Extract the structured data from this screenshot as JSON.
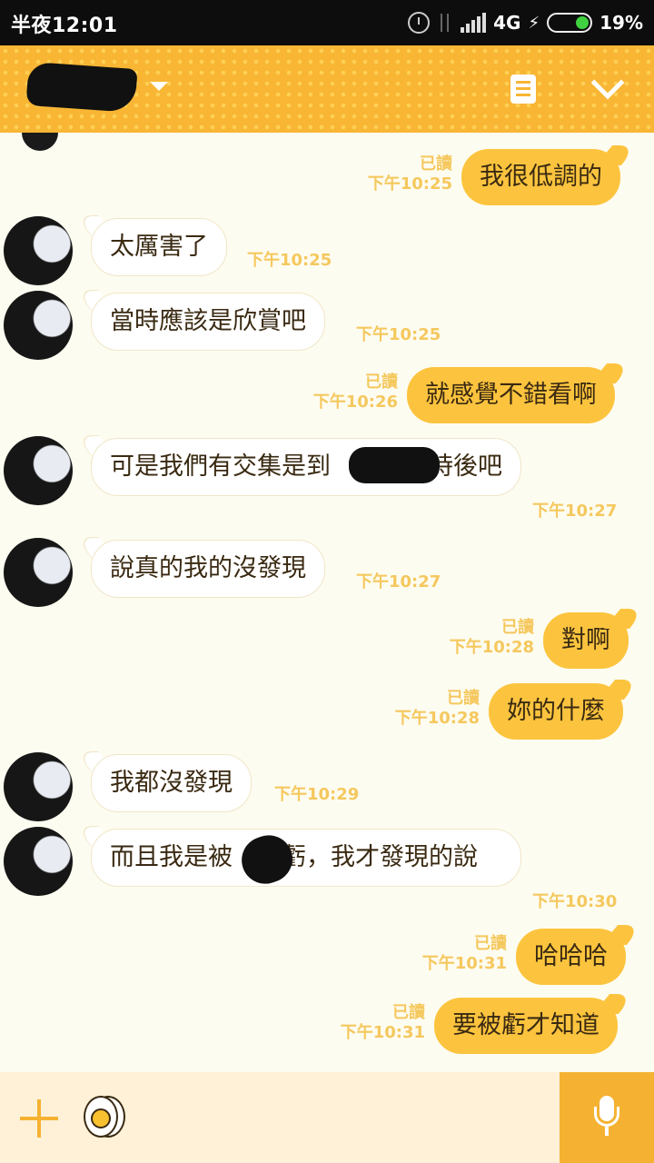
{
  "status_bar": {
    "time": "半夜12:01",
    "network": "4G",
    "battery": "19%",
    "battery_color": "#3fd13f"
  },
  "header": {
    "title": "",
    "icons": [
      "dropdown-caret-icon",
      "note-icon",
      "chevron-down-icon"
    ],
    "background": "#f8b634"
  },
  "messages": [
    {
      "side": "out",
      "text": "我很低調的",
      "read": "已讀",
      "time": "下午10:25"
    },
    {
      "side": "in",
      "text": "太厲害了",
      "time": "下午10:25"
    },
    {
      "side": "in",
      "text": "當時應該是欣賞吧",
      "time": "下午10:25"
    },
    {
      "side": "out",
      "text": "就感覺不錯看啊",
      "read": "已讀",
      "time": "下午10:26"
    },
    {
      "side": "in",
      "text": "可是我們有交集是到　　　小時後吧",
      "time": "下午10:27"
    },
    {
      "side": "in",
      "text": "說真的我的沒發現",
      "time": "下午10:27"
    },
    {
      "side": "out",
      "text": "對啊",
      "read": "已讀",
      "time": "下午10:28"
    },
    {
      "side": "out",
      "text": "妳的什麼",
      "read": "已讀",
      "time": "下午10:28"
    },
    {
      "side": "in",
      "text": "我都沒發現",
      "time": "下午10:29"
    },
    {
      "side": "in",
      "text": "而且我是被　　虧，我才發現的說",
      "time": "下午10:30"
    },
    {
      "side": "out",
      "text": "哈哈哈",
      "read": "已讀",
      "time": "下午10:31"
    },
    {
      "side": "out",
      "text": "要被虧才知道",
      "read": "已讀",
      "time": "下午10:31"
    }
  ],
  "bottom_bar": {
    "icons": [
      "plus-icon",
      "sticker-icon",
      "mic-icon"
    ],
    "accent": "#f5b232"
  }
}
